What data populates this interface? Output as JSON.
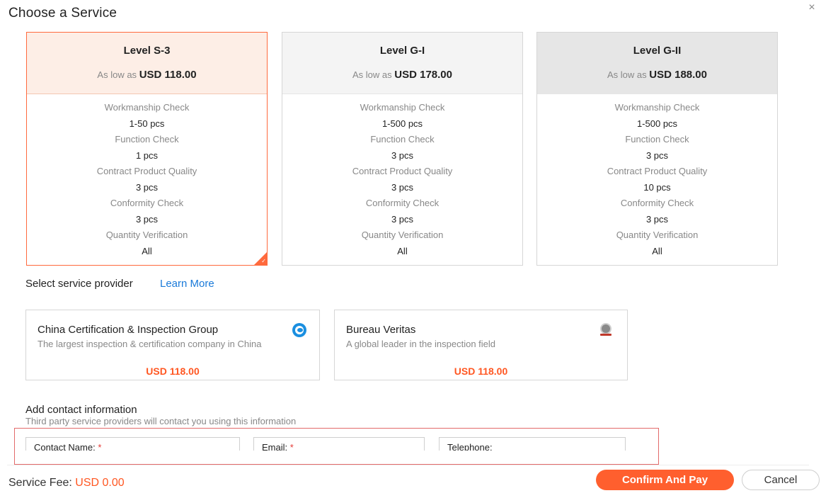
{
  "dialog": {
    "title": "Choose a Service",
    "close_glyph": "×"
  },
  "levels": [
    {
      "name": "Level S-3",
      "price_prefix": "As low as",
      "price": "USD 118.00",
      "selected": true,
      "features": [
        {
          "label": "Workmanship Check",
          "value": "1-50 pcs"
        },
        {
          "label": "Function Check",
          "value": "1 pcs"
        },
        {
          "label": "Contract Product Quality",
          "value": "3 pcs"
        },
        {
          "label": "Conformity Check",
          "value": "3 pcs"
        },
        {
          "label": "Quantity Verification",
          "value": "All"
        }
      ]
    },
    {
      "name": "Level G-I",
      "price_prefix": "As low as",
      "price": "USD 178.00",
      "selected": false,
      "features": [
        {
          "label": "Workmanship Check",
          "value": "1-500 pcs"
        },
        {
          "label": "Function Check",
          "value": "3 pcs"
        },
        {
          "label": "Contract Product Quality",
          "value": "3 pcs"
        },
        {
          "label": "Conformity Check",
          "value": "3 pcs"
        },
        {
          "label": "Quantity Verification",
          "value": "All"
        }
      ]
    },
    {
      "name": "Level G-II",
      "price_prefix": "As low as",
      "price": "USD 188.00",
      "selected": false,
      "features": [
        {
          "label": "Workmanship Check",
          "value": "1-500 pcs"
        },
        {
          "label": "Function Check",
          "value": "3 pcs"
        },
        {
          "label": "Contract Product Quality",
          "value": "10 pcs"
        },
        {
          "label": "Conformity Check",
          "value": "3 pcs"
        },
        {
          "label": "Quantity Verification",
          "value": "All"
        }
      ]
    }
  ],
  "providers": {
    "heading": "Select service provider",
    "learn_more": "Learn More",
    "items": [
      {
        "name": "China Certification & Inspection Group",
        "description": "The largest inspection & certification company in China",
        "price": "USD 118.00",
        "icon": "ccic-logo-icon"
      },
      {
        "name": "Bureau Veritas",
        "description": "A global leader in the inspection field",
        "price": "USD 118.00",
        "icon": "bureau-veritas-logo-icon"
      }
    ]
  },
  "contact": {
    "heading": "Add contact information",
    "subheading": "Third party service providers will contact you using this information",
    "fields": [
      {
        "label": "Contact Name:",
        "required_mark": "*"
      },
      {
        "label": "Email:",
        "required_mark": "*"
      },
      {
        "label": "Telephone:",
        "required_mark": ""
      }
    ]
  },
  "footer": {
    "fee_label": "Service Fee:",
    "fee_value": "USD 0.00",
    "confirm_label": "Confirm And Pay",
    "cancel_label": "Cancel"
  },
  "colors": {
    "accent": "#ff5f2e",
    "link": "#1a7ad9",
    "required": "#e53935"
  }
}
